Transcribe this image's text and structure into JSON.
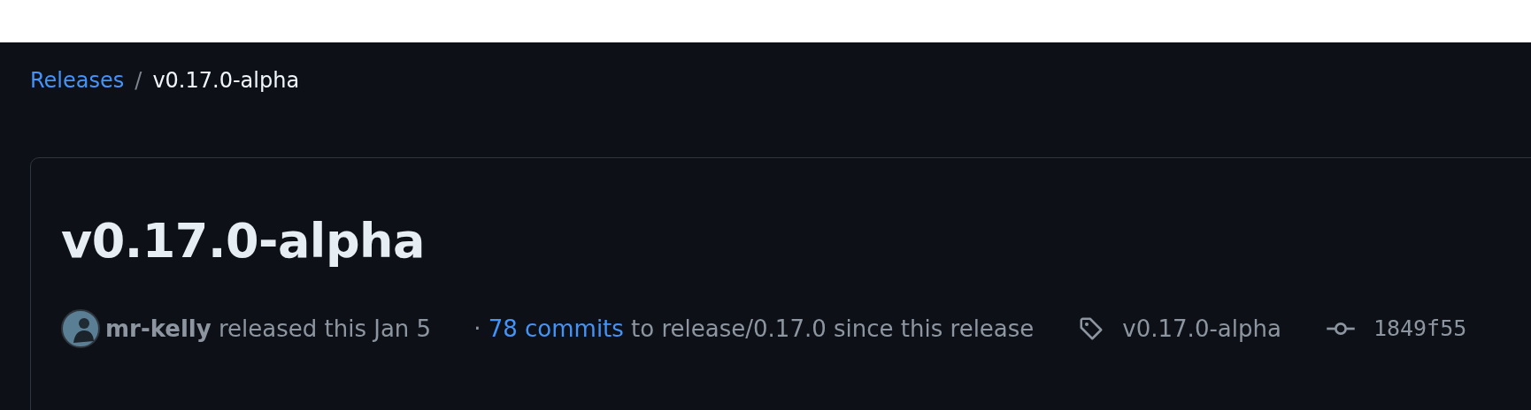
{
  "breadcrumb": {
    "parent": "Releases",
    "separator": "/",
    "current": "v0.17.0-alpha"
  },
  "release": {
    "title": "v0.17.0-alpha",
    "author": "mr-kelly",
    "released_text": "released this Jan 5",
    "separator": "·",
    "commits_link": "78 commits",
    "commits_text": "to release/0.17.0 since this release",
    "tag": "v0.17.0-alpha",
    "commit": "1849f55"
  }
}
